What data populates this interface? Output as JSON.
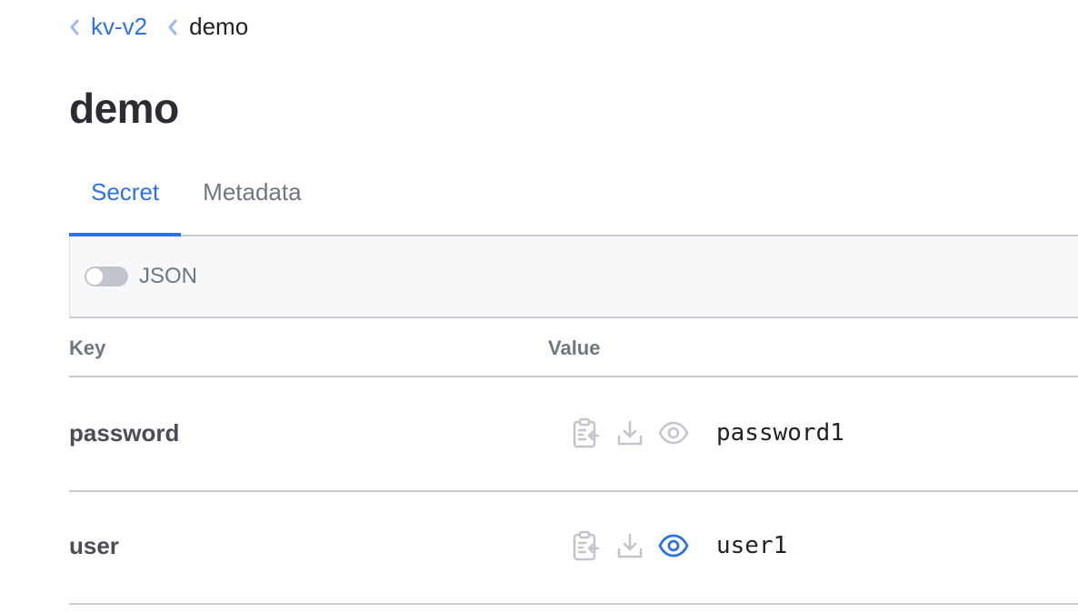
{
  "breadcrumb": {
    "parent": "kv-v2",
    "current": "demo"
  },
  "page": {
    "title": "demo"
  },
  "tabs": [
    {
      "label": "Secret",
      "active": true
    },
    {
      "label": "Metadata",
      "active": false
    }
  ],
  "toolbar": {
    "json_toggle_label": "JSON",
    "json_toggle_on": false
  },
  "table": {
    "columns": [
      "Key",
      "Value"
    ],
    "rows": [
      {
        "key": "password",
        "value": "password1",
        "revealed": false
      },
      {
        "key": "user",
        "value": "user1",
        "revealed": true
      }
    ]
  },
  "icons": {
    "copy": "clipboard-icon",
    "download": "download-icon",
    "reveal": "eye-icon"
  },
  "colors": {
    "accent": "#2e71e5",
    "icon_muted": "#c2c5cc",
    "text": "#3b3d45"
  }
}
